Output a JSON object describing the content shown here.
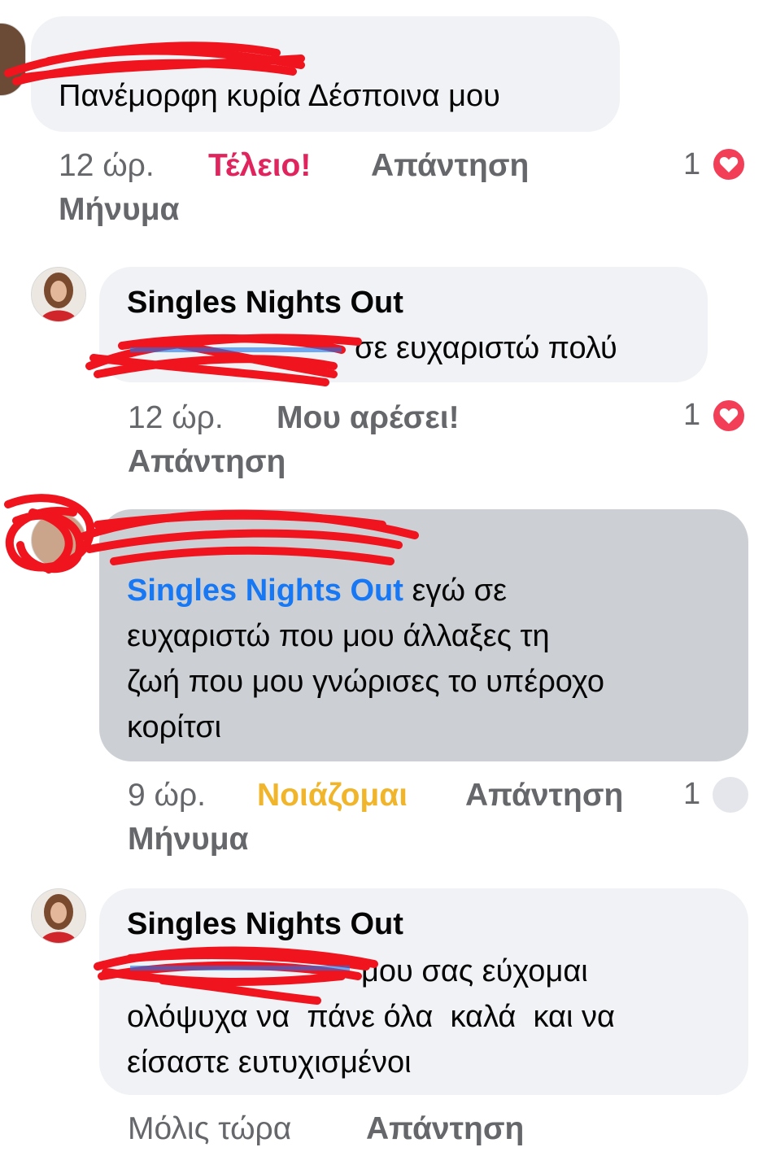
{
  "comments": [
    {
      "author": "",
      "text": "Πανέμορφη κυρία Δέσποινα μου",
      "time": "12 ώρ.",
      "reaction": "Τέλειο!",
      "reply": "Απάντηση",
      "message": "Μήνυμα",
      "reaction_count": "1",
      "reaction_icon": "heart-icon"
    },
    {
      "author": "Singles Nights Out",
      "text": "σε ευχαριστώ πολύ",
      "time": "12 ώρ.",
      "reaction": "Μου αρέσει!",
      "reply": "Απάντηση",
      "reaction_count": "1",
      "reaction_icon": "heart-icon"
    },
    {
      "author": "",
      "mention": "Singles Nights Out",
      "text_line1": " εγώ σε",
      "text_line2": "ευχαριστώ που μου άλλαξες τη",
      "text_line3": "ζωή που μου γνώρισες το υπέροχο",
      "text_line4": "κορίτσι",
      "time": "9 ώρ.",
      "reaction": "Νοιάζομαι",
      "reply": "Απάντηση",
      "message": "Μήνυμα",
      "reaction_count": "1",
      "reaction_icon": "care-icon"
    },
    {
      "author": "Singles Nights Out",
      "text_line1": "μου σας εύχομαι",
      "text_line2": "ολόψυχα να  πάνε όλα  καλά  και να",
      "text_line3": "είσαστε ευτυχισμένοι",
      "time": "Μόλις τώρα",
      "reply": "Απάντηση"
    }
  ],
  "colors": {
    "bubble": "#f0f2f5",
    "bubble_active": "#ccd0d5",
    "mention": "#1877f2",
    "love": "#e0245e",
    "care": "#f0b52a",
    "meta": "#65676b",
    "redaction": "#f0141e"
  }
}
